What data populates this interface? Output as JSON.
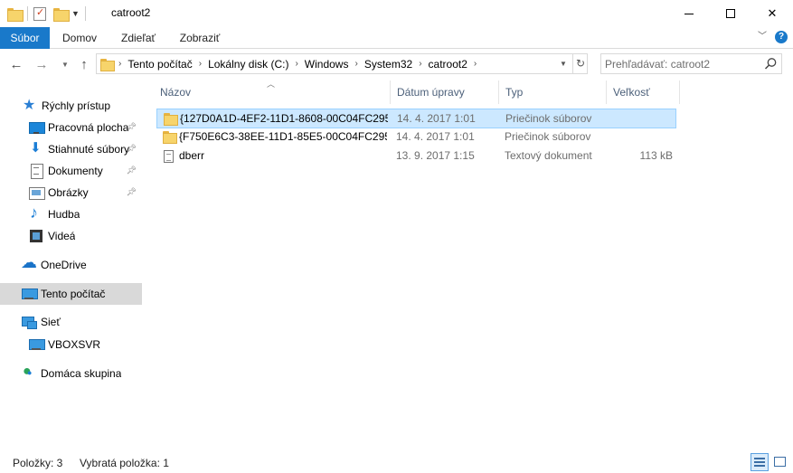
{
  "window": {
    "title": "catroot2"
  },
  "ribbon": {
    "tabs": [
      {
        "label": "Súbor"
      },
      {
        "label": "Domov"
      },
      {
        "label": "Zdieľať"
      },
      {
        "label": "Zobraziť"
      }
    ]
  },
  "address": {
    "segments": [
      "Tento počítač",
      "Lokálny disk (C:)",
      "Windows",
      "System32",
      "catroot2"
    ]
  },
  "search": {
    "placeholder": "Prehľadávať: catroot2"
  },
  "nav_pane": {
    "items": [
      {
        "label": "Rýchly prístup",
        "icon": "star-icon"
      },
      {
        "label": "Pracovná plocha",
        "icon": "desktop-icon",
        "pinned": true
      },
      {
        "label": "Stiahnuté súbory",
        "icon": "download-icon",
        "pinned": true
      },
      {
        "label": "Dokumenty",
        "icon": "document-icon",
        "pinned": true
      },
      {
        "label": "Obrázky",
        "icon": "pictures-icon",
        "pinned": true
      },
      {
        "label": "Hudba",
        "icon": "music-icon"
      },
      {
        "label": "Videá",
        "icon": "video-icon"
      },
      {
        "label": "OneDrive",
        "icon": "cloud-icon"
      },
      {
        "label": "Tento počítač",
        "icon": "computer-icon",
        "selected": true
      },
      {
        "label": "Sieť",
        "icon": "network-icon"
      },
      {
        "label": "VBOXSVR",
        "icon": "computer-icon"
      },
      {
        "label": "Domáca skupina",
        "icon": "homegroup-icon"
      }
    ]
  },
  "file_list": {
    "columns": [
      "Názov",
      "Dátum úpravy",
      "Typ",
      "Veľkosť"
    ],
    "rows": [
      {
        "name": "{127D0A1D-4EF2-11D1-8608-00C04FC295...",
        "date": "14. 4. 2017 1:01",
        "type": "Priečinok súborov",
        "size": "",
        "icon": "folder-icon",
        "selected": true
      },
      {
        "name": "{F750E6C3-38EE-11D1-85E5-00C04FC295...",
        "date": "14. 4. 2017 1:01",
        "type": "Priečinok súborov",
        "size": "",
        "icon": "folder-icon",
        "selected": false
      },
      {
        "name": "dberr",
        "date": "13. 9. 2017 1:15",
        "type": "Textový dokument",
        "size": "113 kB",
        "icon": "text-file-icon",
        "selected": false
      }
    ]
  },
  "status": {
    "item_count": "Položky: 3",
    "selected": "Vybratá položka: 1"
  },
  "colors": {
    "accent": "#1979ca",
    "selection": "#cce8ff",
    "nav_selection": "#d9d9d9"
  }
}
